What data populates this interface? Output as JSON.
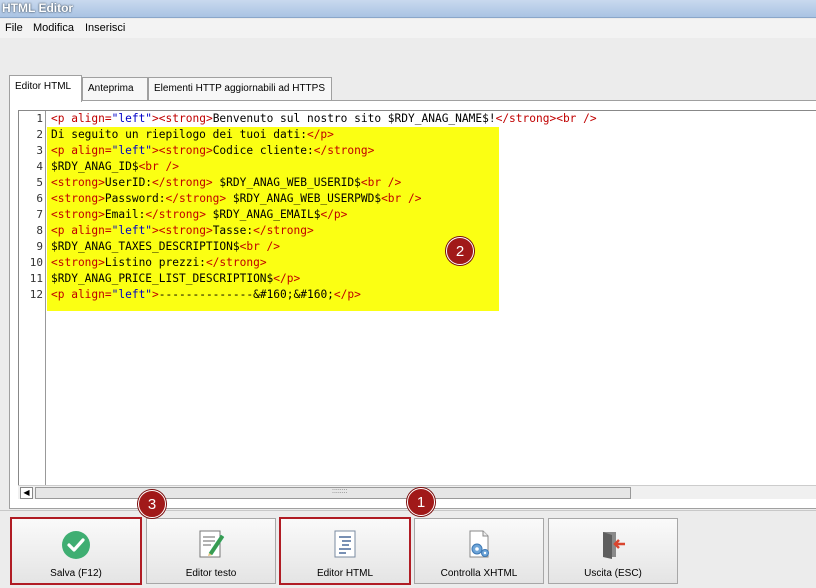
{
  "window": {
    "title": "HTML Editor"
  },
  "menu": [
    {
      "label": "File"
    },
    {
      "label": "Modifica"
    },
    {
      "label": "Inserisci"
    }
  ],
  "tabs": [
    {
      "label": "Editor HTML",
      "active": true
    },
    {
      "label": "Anteprima",
      "active": false
    },
    {
      "label": "Elementi HTTP aggiornabili ad HTTPS",
      "active": false
    }
  ],
  "editor": {
    "line_numbers": [
      "1",
      "2",
      "3",
      "4",
      "5",
      "6",
      "7",
      "8",
      "9",
      "10",
      "11",
      "12"
    ],
    "lines": [
      "<p align=\"left\"><strong>Benvenuto sul nostro sito $RDY_ANAG_NAME$!</strong><br />",
      "Di seguito un riepilogo dei tuoi dati:</p>",
      "<p align=\"left\"><strong>Codice cliente:</strong>",
      "$RDY_ANAG_ID$<br />",
      "<strong>UserID:</strong> $RDY_ANAG_WEB_USERID$<br />",
      "<strong>Password:</strong> $RDY_ANAG_WEB_USERPWD$<br />",
      "<strong>Email:</strong> $RDY_ANAG_EMAIL$</p>",
      "<p align=\"left\"><strong>Tasse:</strong>",
      "$RDY_ANAG_TAXES_DESCRIPTION$<br />",
      "<strong>Listino prezzi:</strong>",
      "$RDY_ANAG_PRICE_LIST_DESCRIPTION$</p>",
      "<p align=\"left\">--------------&#160;&#160;</p>"
    ],
    "colors": {
      "tag": "#c00000",
      "attr_value": "#0000c8",
      "highlight": "#fbff13"
    }
  },
  "buttons": [
    {
      "label": "Salva (F12)",
      "icon": "check-circle-icon"
    },
    {
      "label": "Editor testo",
      "icon": "text-editor-icon"
    },
    {
      "label": "Editor HTML",
      "icon": "html-editor-icon"
    },
    {
      "label": "Controlla XHTML",
      "icon": "document-gear-icon"
    },
    {
      "label": "Uscita (ESC)",
      "icon": "exit-door-icon"
    }
  ],
  "annotations": [
    "1",
    "2",
    "3"
  ],
  "accent": {
    "annotation": "#a11919"
  }
}
